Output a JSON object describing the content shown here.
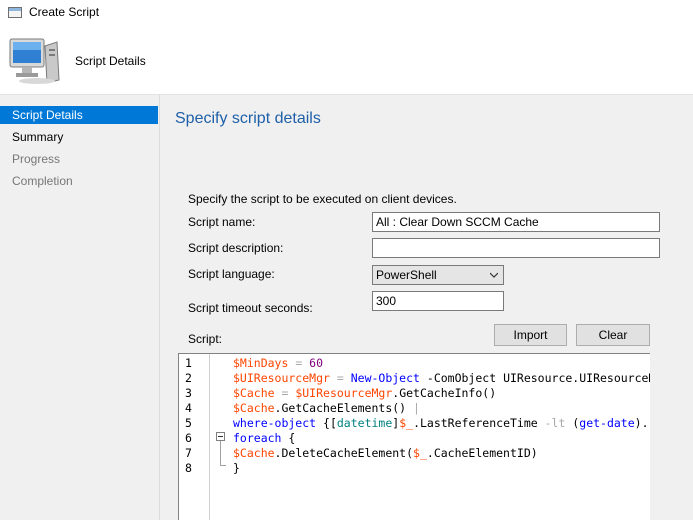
{
  "window": {
    "title": "Create Script"
  },
  "header": {
    "title": "Script Details"
  },
  "sidebar": {
    "items": [
      {
        "label": "Script Details",
        "state": "active"
      },
      {
        "label": "Summary",
        "state": "enabled"
      },
      {
        "label": "Progress",
        "state": "disabled"
      },
      {
        "label": "Completion",
        "state": "disabled"
      }
    ]
  },
  "main": {
    "heading": "Specify script details",
    "intro": "Specify the script to be executed on client devices.",
    "fields": {
      "name_label": "Script name:",
      "name_value": "All : Clear Down SCCM Cache",
      "description_label": "Script description:",
      "description_value": "",
      "language_label": "Script language:",
      "language_value": "PowerShell",
      "timeout_label": "Script timeout seconds:",
      "timeout_value": "300",
      "script_label": "Script:"
    },
    "buttons": {
      "import": "Import",
      "clear": "Clear"
    },
    "script": {
      "line_numbers": [
        "1",
        "2",
        "3",
        "4",
        "5",
        "6",
        "7",
        "8"
      ],
      "lines": [
        [
          {
            "t": "$MinDays",
            "c": "var"
          },
          {
            "t": " = ",
            "c": "op"
          },
          {
            "t": "60",
            "c": "num"
          }
        ],
        [
          {
            "t": "$UIResourceMgr",
            "c": "var"
          },
          {
            "t": " = ",
            "c": "op"
          },
          {
            "t": "New-Object",
            "c": "kw"
          },
          {
            "t": " -ComObject ",
            "c": "plain"
          },
          {
            "t": "UIResource.UIResourceMgr",
            "c": "plain"
          }
        ],
        [
          {
            "t": "$Cache",
            "c": "var"
          },
          {
            "t": " = ",
            "c": "op"
          },
          {
            "t": "$UIResourceMgr",
            "c": "var"
          },
          {
            "t": ".GetCacheInfo()",
            "c": "plain"
          }
        ],
        [
          {
            "t": "$Cache",
            "c": "var"
          },
          {
            "t": ".GetCacheElements() ",
            "c": "plain"
          },
          {
            "t": "|",
            "c": "op"
          }
        ],
        [
          {
            "t": "where-object",
            "c": "kw"
          },
          {
            "t": " {[",
            "c": "plain"
          },
          {
            "t": "datetime",
            "c": "typ"
          },
          {
            "t": "]",
            "c": "plain"
          },
          {
            "t": "$_",
            "c": "var"
          },
          {
            "t": ".LastReferenceTime ",
            "c": "plain"
          },
          {
            "t": "-lt",
            "c": "op"
          },
          {
            "t": " (",
            "c": "plain"
          },
          {
            "t": "get-date",
            "c": "kw"
          },
          {
            "t": ").",
            "c": "plain"
          }
        ],
        [
          {
            "t": "foreach",
            "c": "kw"
          },
          {
            "t": " {",
            "c": "plain"
          }
        ],
        [
          {
            "t": "$Cache",
            "c": "var"
          },
          {
            "t": ".DeleteCacheElement(",
            "c": "plain"
          },
          {
            "t": "$_",
            "c": "var"
          },
          {
            "t": ".CacheElementID)",
            "c": "plain"
          }
        ],
        [
          {
            "t": "}",
            "c": "plain"
          }
        ]
      ]
    }
  }
}
